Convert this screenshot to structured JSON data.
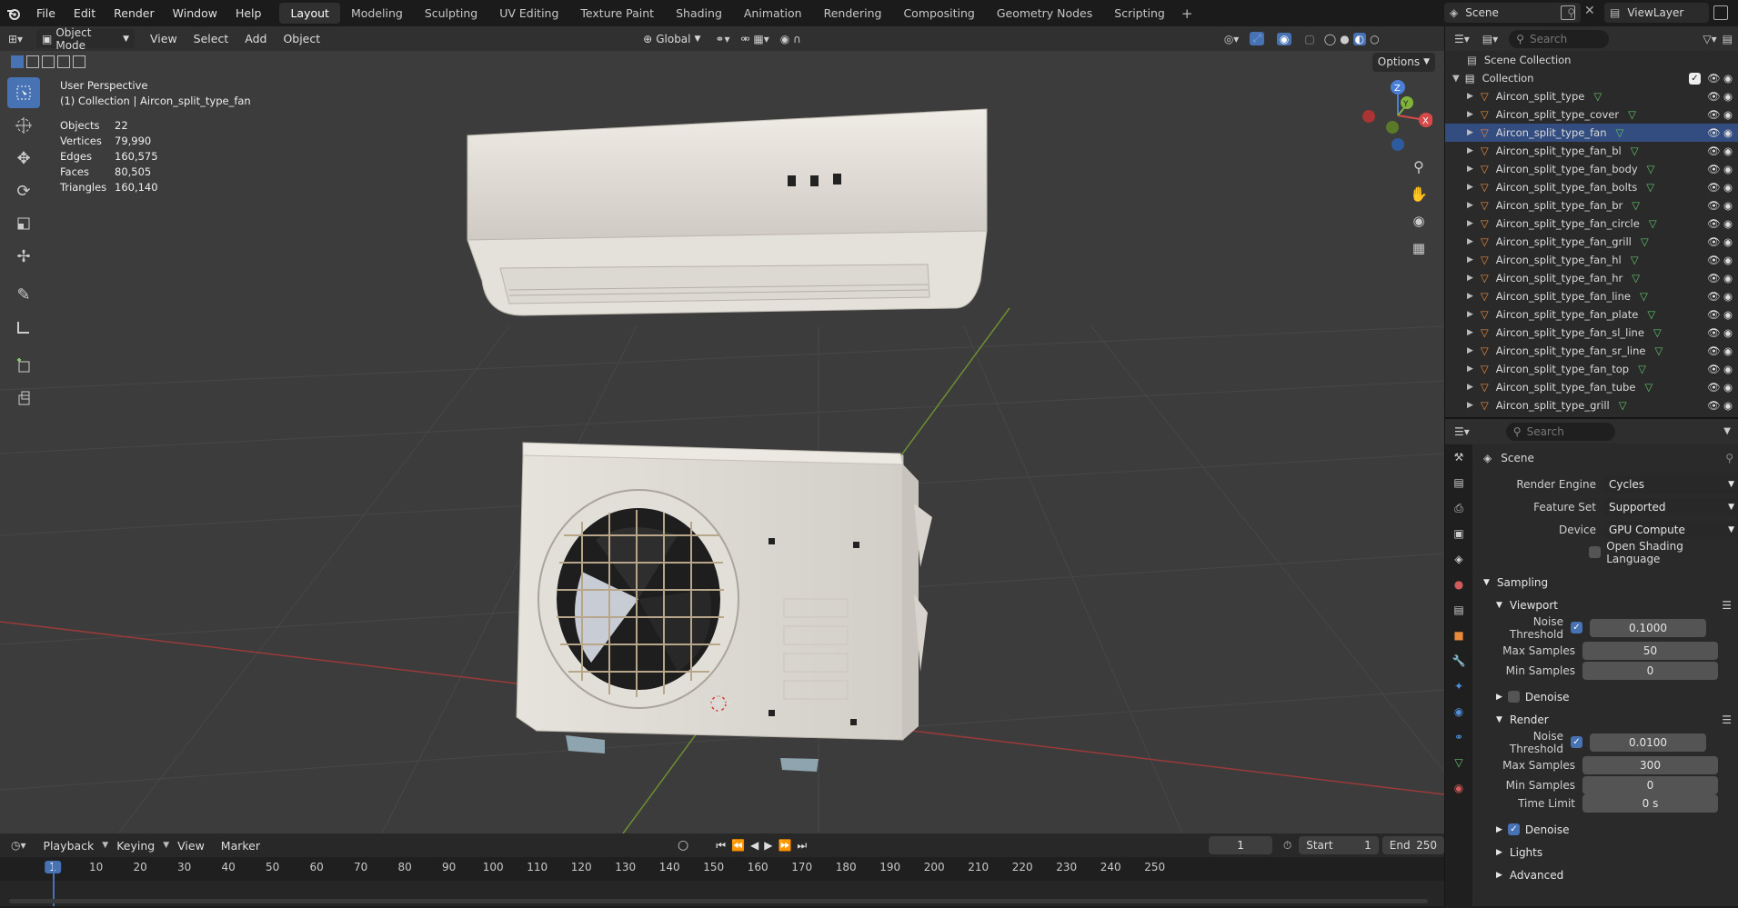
{
  "topbar": {
    "menus": [
      "File",
      "Edit",
      "Render",
      "Window",
      "Help"
    ],
    "workspaces": [
      "Layout",
      "Modeling",
      "Sculpting",
      "UV Editing",
      "Texture Paint",
      "Shading",
      "Animation",
      "Rendering",
      "Compositing",
      "Geometry Nodes",
      "Scripting"
    ],
    "active_workspace": "Layout",
    "scene": "Scene",
    "view_layer": "ViewLayer"
  },
  "viewport": {
    "mode": "Object Mode",
    "menus": [
      "View",
      "Select",
      "Add",
      "Object"
    ],
    "orientation": "Global",
    "options_label": "Options",
    "perspective": "User Perspective",
    "context": "(1) Collection | Aircon_split_type_fan",
    "stats": [
      {
        "label": "Objects",
        "value": "22"
      },
      {
        "label": "Vertices",
        "value": "79,990"
      },
      {
        "label": "Edges",
        "value": "160,575"
      },
      {
        "label": "Faces",
        "value": "80,505"
      },
      {
        "label": "Triangles",
        "value": "160,140"
      }
    ],
    "gizmo": {
      "z": "Z",
      "y": "Y",
      "x": "X"
    }
  },
  "timeline": {
    "menus": [
      "Playback",
      "Keying",
      "View",
      "Marker"
    ],
    "current_frame": "1",
    "start_label": "Start",
    "start": "1",
    "end_label": "End",
    "end": "250",
    "ruler": [
      "1",
      "10",
      "20",
      "30",
      "40",
      "50",
      "60",
      "70",
      "80",
      "90",
      "100",
      "110",
      "120",
      "130",
      "140",
      "150",
      "160",
      "170",
      "180",
      "190",
      "200",
      "210",
      "220",
      "230",
      "240",
      "250"
    ]
  },
  "outliner": {
    "search_placeholder": "Search",
    "root": "Scene Collection",
    "collection": "Collection",
    "items": [
      "Aircon_split_type",
      "Aircon_split_type_cover",
      "Aircon_split_type_fan",
      "Aircon_split_type_fan_bl",
      "Aircon_split_type_fan_body",
      "Aircon_split_type_fan_bolts",
      "Aircon_split_type_fan_br",
      "Aircon_split_type_fan_circle",
      "Aircon_split_type_fan_grill",
      "Aircon_split_type_fan_hl",
      "Aircon_split_type_fan_hr",
      "Aircon_split_type_fan_line",
      "Aircon_split_type_fan_plate",
      "Aircon_split_type_fan_sl_line",
      "Aircon_split_type_fan_sr_line",
      "Aircon_split_type_fan_top",
      "Aircon_split_type_fan_tube",
      "Aircon_split_type_grill"
    ]
  },
  "properties": {
    "search_placeholder": "Search",
    "context": "Scene",
    "render_engine_label": "Render Engine",
    "render_engine": "Cycles",
    "feature_set_label": "Feature Set",
    "feature_set": "Supported",
    "device_label": "Device",
    "device": "GPU Compute",
    "osl_label": "Open Shading Language",
    "sampling_label": "Sampling",
    "viewport_label": "Viewport",
    "noise_threshold_label": "Noise Threshold",
    "viewport_noise_threshold": "0.1000",
    "max_samples_label": "Max Samples",
    "viewport_max_samples": "50",
    "min_samples_label": "Min Samples",
    "viewport_min_samples": "0",
    "denoise_label": "Denoise",
    "render_label": "Render",
    "render_noise_threshold": "0.0100",
    "render_max_samples": "300",
    "render_min_samples": "0",
    "time_limit_label": "Time Limit",
    "render_time_limit": "0 s",
    "lights_label": "Lights",
    "advanced_label": "Advanced"
  }
}
